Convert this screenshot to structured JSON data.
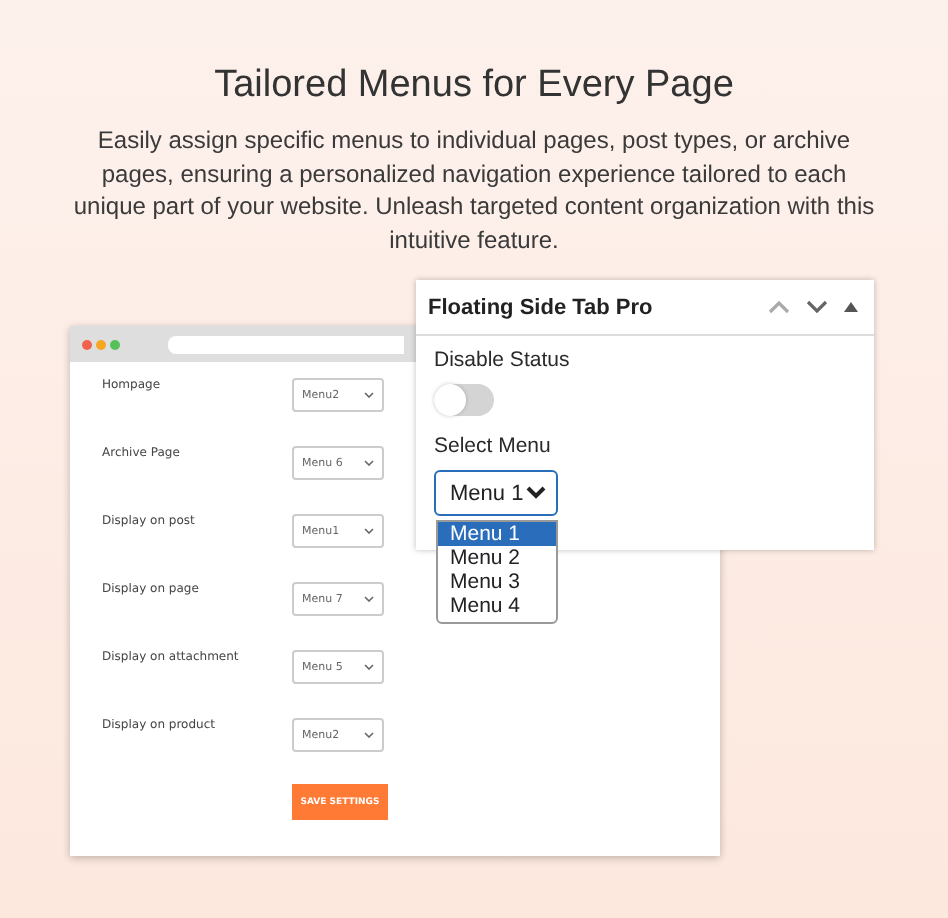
{
  "heading": "Tailored Menus for Every Page",
  "description": "Easily assign specific menus to individual pages, post types, or archive pages, ensuring a personalized navigation experience tailored to each unique part of your website. Unleash targeted content organization with this intuitive feature.",
  "settings_window": {
    "rows": [
      {
        "label": "Hompage",
        "value": "Menu2"
      },
      {
        "label": "Archive Page",
        "value": "Menu 6"
      },
      {
        "label": "Display on post",
        "value": "Menu1"
      },
      {
        "label": "Display on page",
        "value": "Menu 7"
      },
      {
        "label": "Display on attachment",
        "value": "Menu 5"
      },
      {
        "label": "Display on product",
        "value": "Menu2"
      }
    ],
    "save_button": "SAVE SETTINGS"
  },
  "panel": {
    "title": "Floating Side Tab Pro",
    "disable_status": {
      "label": "Disable Status",
      "on": false
    },
    "select_menu": {
      "label": "Select Menu",
      "value": "Menu 1",
      "expanded": true,
      "options": [
        {
          "label": "Menu 1",
          "selected": true
        },
        {
          "label": "Menu 2",
          "selected": false
        },
        {
          "label": "Menu 3",
          "selected": false
        },
        {
          "label": "Menu 4",
          "selected": false
        }
      ]
    }
  }
}
